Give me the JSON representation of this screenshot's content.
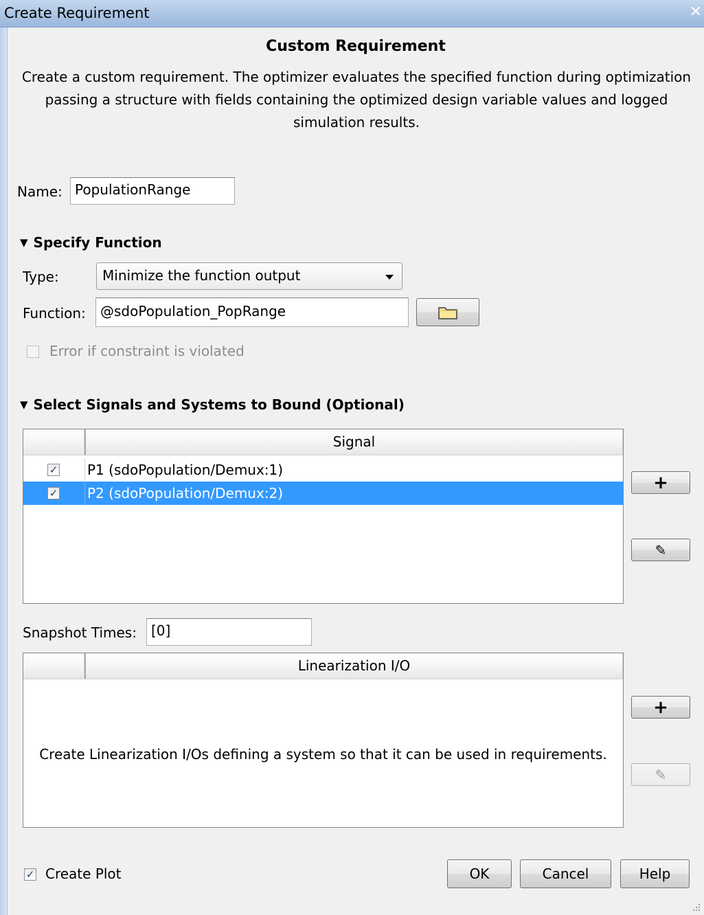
{
  "window": {
    "title": "Create Requirement",
    "close_glyph": "✕"
  },
  "header": {
    "heading": "Custom Requirement",
    "description": "Create a custom requirement. The optimizer evaluates the specified function during optimization passing a structure with fields containing the optimized design variable values and logged simulation results."
  },
  "name_field": {
    "label": "Name:",
    "value": "PopulationRange"
  },
  "specify_function": {
    "title": "Specify Function",
    "type_label": "Type:",
    "type_value": "Minimize the function output",
    "function_label": "Function:",
    "function_value": "@sdoPopulation_PopRange",
    "error_checkbox_label": "Error if constraint is violated",
    "error_checked": false
  },
  "signals": {
    "title": "Select Signals and Systems to Bound (Optional)",
    "column_header": "Signal",
    "rows": [
      {
        "label": "P1 (sdoPopulation/Demux:1)",
        "checked": true,
        "selected": false
      },
      {
        "label": "P2 (sdoPopulation/Demux:2)",
        "checked": true,
        "selected": true
      }
    ],
    "add_glyph": "+",
    "edit_glyph": "✎"
  },
  "snapshot": {
    "label": "Snapshot Times:",
    "value": "[0]"
  },
  "linearization": {
    "column_header": "Linearization I/O",
    "empty_message": "Create Linearization I/Os defining a system so that it can be used in requirements.",
    "add_glyph": "+",
    "edit_glyph": "✎"
  },
  "footer": {
    "create_plot_label": "Create Plot",
    "create_plot_checked": true,
    "ok_label": "OK",
    "cancel_label": "Cancel",
    "help_label": "Help"
  },
  "colors": {
    "selection": "#3399ff",
    "titlebar": "#a9c3e3"
  }
}
